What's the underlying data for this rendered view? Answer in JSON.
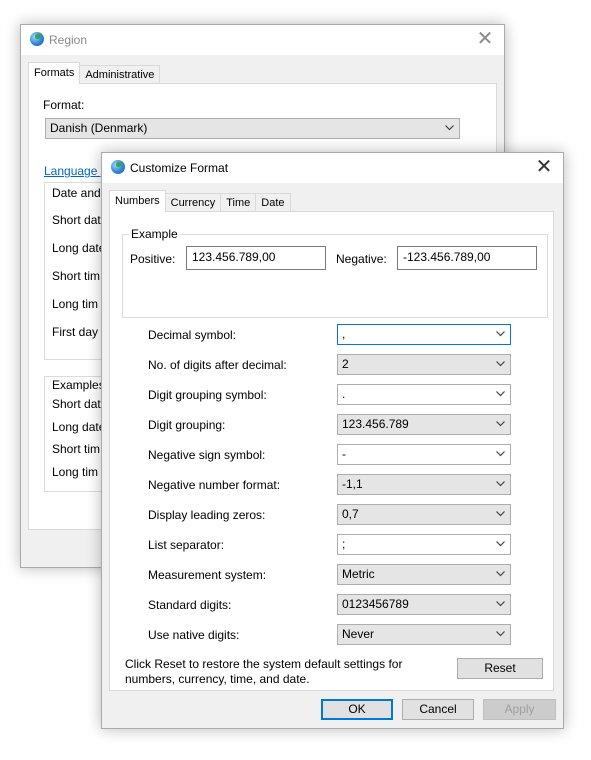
{
  "region": {
    "title": "Region",
    "tabs": [
      "Formats",
      "Administrative"
    ],
    "format_label": "Format:",
    "format_value": "Danish (Denmark)",
    "language_link": "Language p",
    "date_group_title": "Date and",
    "date_rows": [
      "Short dat",
      "Long date",
      "Short tim",
      "Long tim",
      "First day c"
    ],
    "examples_title": "Examples",
    "example_rows": [
      "Short dat",
      "Long date",
      "Short tim",
      "Long tim"
    ]
  },
  "customize": {
    "title": "Customize Format",
    "tabs": [
      "Numbers",
      "Currency",
      "Time",
      "Date"
    ],
    "example": {
      "title": "Example",
      "positive_label": "Positive:",
      "positive_value": "123.456.789,00",
      "negative_label": "Negative:",
      "negative_value": "-123.456.789,00"
    },
    "settings": [
      {
        "label": "Decimal symbol:",
        "value": ","
      },
      {
        "label": "No. of digits after decimal:",
        "value": "2"
      },
      {
        "label": "Digit grouping symbol:",
        "value": "."
      },
      {
        "label": "Digit grouping:",
        "value": "123.456.789"
      },
      {
        "label": "Negative sign symbol:",
        "value": "-"
      },
      {
        "label": "Negative number format:",
        "value": "-1,1"
      },
      {
        "label": "Display leading zeros:",
        "value": "0,7"
      },
      {
        "label": "List separator:",
        "value": ";"
      },
      {
        "label": "Measurement system:",
        "value": "Metric"
      },
      {
        "label": "Standard digits:",
        "value": "0123456789"
      },
      {
        "label": "Use native digits:",
        "value": "Never"
      }
    ],
    "reset_text_line1": "Click Reset to restore the system default settings for",
    "reset_text_line2": "numbers, currency, time, and date.",
    "reset_label": "Reset",
    "ok_label": "OK",
    "cancel_label": "Cancel",
    "apply_label": "Apply"
  }
}
